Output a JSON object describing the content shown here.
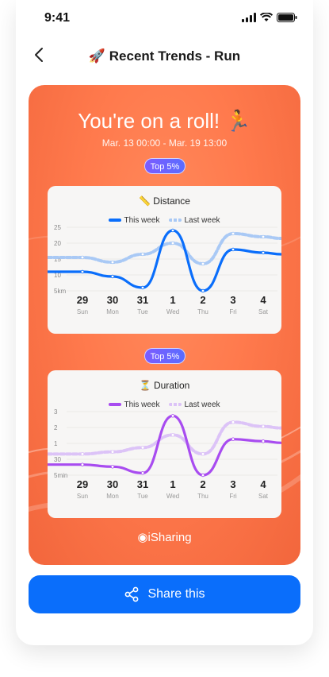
{
  "status": {
    "time": "9:41"
  },
  "nav": {
    "title": "🚀 Recent Trends - Run",
    "back_icon": "chevron-left-icon"
  },
  "card": {
    "headline": "You're on a roll! 🏃",
    "date_range": "Mar. 13 00:00 - Mar. 19 13:00",
    "brand": "iSharing",
    "colors": {
      "this_week_distance": "#0a6efb",
      "this_week_duration": "#a84cf0",
      "card_bg": "#ff7a4d"
    }
  },
  "charts": [
    {
      "badge": "Top 5%",
      "title": "📏 Distance",
      "legend_this": "This week",
      "legend_last": "Last week",
      "y_ticks": [
        "25",
        "20",
        "15",
        "10",
        "5km"
      ],
      "days": [
        "29",
        "30",
        "31",
        "1",
        "2",
        "3",
        "4"
      ],
      "weekdays": [
        "Sun",
        "Mon",
        "Tue",
        "Wed",
        "Thu",
        "Fri",
        "Sat"
      ]
    },
    {
      "badge": "Top 5%",
      "title": "⏳ Duration",
      "legend_this": "This week",
      "legend_last": "Last week",
      "y_ticks": [
        "3",
        "2",
        "1",
        "30",
        "5min"
      ],
      "days": [
        "29",
        "30",
        "31",
        "1",
        "2",
        "3",
        "4"
      ],
      "weekdays": [
        "Sun",
        "Mon",
        "Tue",
        "Wed",
        "Thu",
        "Fri",
        "Sat"
      ]
    }
  ],
  "chart_data": [
    {
      "type": "line",
      "categories": [
        "Sun",
        "Mon",
        "Tue",
        "Wed",
        "Thu",
        "Fri",
        "Sat"
      ],
      "series": [
        {
          "name": "This week",
          "values": [
            11,
            9.5,
            6,
            24,
            5,
            18,
            17
          ]
        },
        {
          "name": "Last week",
          "values": [
            15.5,
            14,
            16.5,
            20,
            13.5,
            23,
            22
          ]
        }
      ],
      "ylim": [
        5,
        25
      ]
    },
    {
      "type": "line",
      "categories": [
        "Sun",
        "Mon",
        "Tue",
        "Wed",
        "Thu",
        "Fri",
        "Sat"
      ],
      "series": [
        {
          "name": "This week",
          "values": [
            0.5,
            0.4,
            0.1,
            2.8,
            0.0,
            1.7,
            1.6
          ]
        },
        {
          "name": "Last week",
          "values": [
            1.0,
            1.1,
            1.3,
            1.9,
            1.0,
            2.5,
            2.3
          ]
        }
      ],
      "ylim": [
        0,
        3
      ]
    }
  ],
  "share": {
    "label": "Share this",
    "icon": "share-icon"
  }
}
